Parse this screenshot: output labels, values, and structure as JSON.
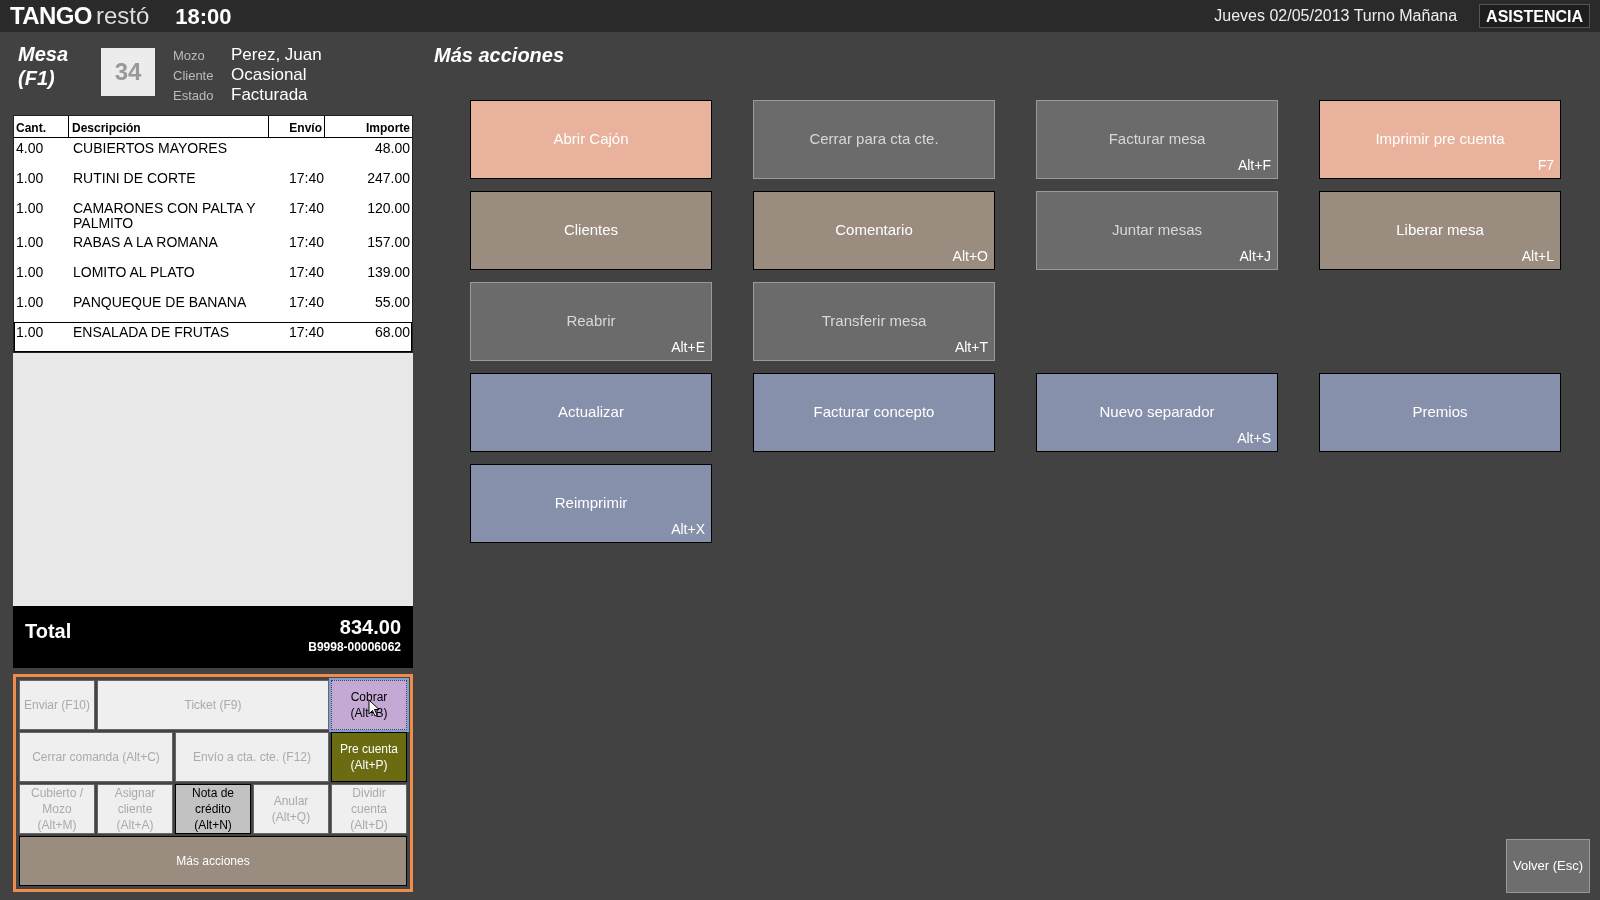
{
  "header": {
    "logo": {
      "brand": "TANGO",
      "product": "restó"
    },
    "time": "18:00",
    "date_shift": "Jueves 02/05/2013 Turno Mañana",
    "assist_button": "ASISTENCIA"
  },
  "mesa": {
    "title": "Mesa",
    "shortcut": "(F1)",
    "number": "34",
    "fields": [
      {
        "label": "Mozo",
        "value": "Perez, Juan"
      },
      {
        "label": "Cliente",
        "value": "Ocasional"
      },
      {
        "label": "Estado",
        "value": "Facturada"
      }
    ]
  },
  "table": {
    "columns": [
      "Cant.",
      "Descripción",
      "Envío",
      "Importe"
    ],
    "rows": [
      {
        "cells": [
          "4.00",
          "CUBIERTOS MAYORES",
          null,
          "48.00"
        ],
        "selected": false
      },
      {
        "cells": [
          "1.00",
          "RUTINI DE CORTE",
          "17:40",
          "247.00"
        ],
        "selected": false
      },
      {
        "cells": [
          "1.00",
          "CAMARONES CON PALTA Y PALMITO",
          "17:40",
          "120.00"
        ],
        "selected": false
      },
      {
        "cells": [
          "1.00",
          "RABAS A LA ROMANA",
          "17:40",
          "157.00"
        ],
        "selected": false
      },
      {
        "cells": [
          "1.00",
          "LOMITO AL PLATO",
          "17:40",
          "139.00"
        ],
        "selected": false
      },
      {
        "cells": [
          "1.00",
          "PANQUEQUE DE BANANA",
          "17:40",
          "55.00"
        ],
        "selected": false
      },
      {
        "cells": [
          "1.00",
          "ENSALADA DE FRUTAS",
          "17:40",
          "68.00"
        ],
        "selected": true
      }
    ]
  },
  "total": {
    "label": "Total",
    "amount": "834.00",
    "voucher": "B9998-00006062"
  },
  "actions": [
    {
      "label": "Enviar (F10)",
      "kind": "small",
      "disabled": true,
      "focused": false
    },
    {
      "label": "Ticket (F9)",
      "kind": "wide",
      "disabled": true,
      "focused": false
    },
    {
      "label": "Cobrar (Alt+B)",
      "kind": "small",
      "disabled": false,
      "focused": true,
      "color": "#c3a9d3"
    },
    {
      "label": "Cerrar comanda (Alt+C)",
      "kind": "half",
      "disabled": true,
      "focused": false
    },
    {
      "label": "Envío a cta. cte. (F12)",
      "kind": "half",
      "disabled": true,
      "focused": false
    },
    {
      "label": "Pre cuenta (Alt+P)",
      "kind": "small",
      "disabled": false,
      "focused": false,
      "color": "#6b6b12"
    },
    {
      "label": "Cubierto / Mozo (Alt+M)",
      "kind": "small",
      "disabled": true,
      "focused": false
    },
    {
      "label": "Asignar cliente (Alt+A)",
      "kind": "small",
      "disabled": true,
      "focused": false
    },
    {
      "label": "Nota de crédito (Alt+N)",
      "kind": "small",
      "disabled": false,
      "focused": false,
      "color": "#c2c2c2"
    },
    {
      "label": "Anular (Alt+Q)",
      "kind": "small",
      "disabled": true,
      "focused": false
    },
    {
      "label": "Dividir cuenta (Alt+D)",
      "kind": "small",
      "disabled": true,
      "focused": false
    },
    {
      "label": "Más acciones",
      "kind": "full",
      "disabled": false,
      "focused": false,
      "color": "#9a8d80"
    }
  ],
  "more_actions": {
    "title": "Más acciones",
    "rows": [
      [
        {
          "label": "Abrir Cajón",
          "disabled": false,
          "color": "#e8b29c"
        },
        {
          "label": "Cerrar para cta cte.",
          "disabled": true,
          "color": "#6b6b6b"
        },
        {
          "label": "Facturar mesa",
          "shortcut": "Alt+F",
          "disabled": true,
          "color": "#6b6b6b"
        },
        {
          "label": "Imprimir pre cuenta",
          "shortcut": "F7",
          "disabled": false,
          "color": "#e8b29c"
        }
      ],
      [
        {
          "label": "Clientes",
          "disabled": false,
          "color": "#9a8d80"
        },
        {
          "label": "Comentario",
          "shortcut": "Alt+O",
          "disabled": false,
          "color": "#9a8d80"
        },
        {
          "label": "Juntar mesas",
          "shortcut": "Alt+J",
          "disabled": true,
          "color": "#6b6b6b"
        },
        {
          "label": "Liberar mesa",
          "shortcut": "Alt+L",
          "disabled": false,
          "color": "#9a8d80"
        }
      ],
      [
        {
          "label": "Reabrir",
          "shortcut": "Alt+E",
          "disabled": true,
          "color": "#6b6b6b"
        },
        {
          "label": "Transferir mesa",
          "shortcut": "Alt+T",
          "disabled": true,
          "color": "#6b6b6b"
        }
      ],
      [
        {
          "label": "Actualizar",
          "disabled": false,
          "color": "#8690aa"
        },
        {
          "label": "Facturar concepto",
          "disabled": false,
          "color": "#8690aa"
        },
        {
          "label": "Nuevo separador",
          "shortcut": "Alt+S",
          "disabled": false,
          "color": "#8690aa"
        },
        {
          "label": "Premios",
          "disabled": false,
          "color": "#8690aa"
        }
      ],
      [
        {
          "label": "Reimprimir",
          "shortcut": "Alt+X",
          "disabled": false,
          "color": "#8690aa"
        }
      ]
    ]
  },
  "back_button": "Volver (Esc)"
}
